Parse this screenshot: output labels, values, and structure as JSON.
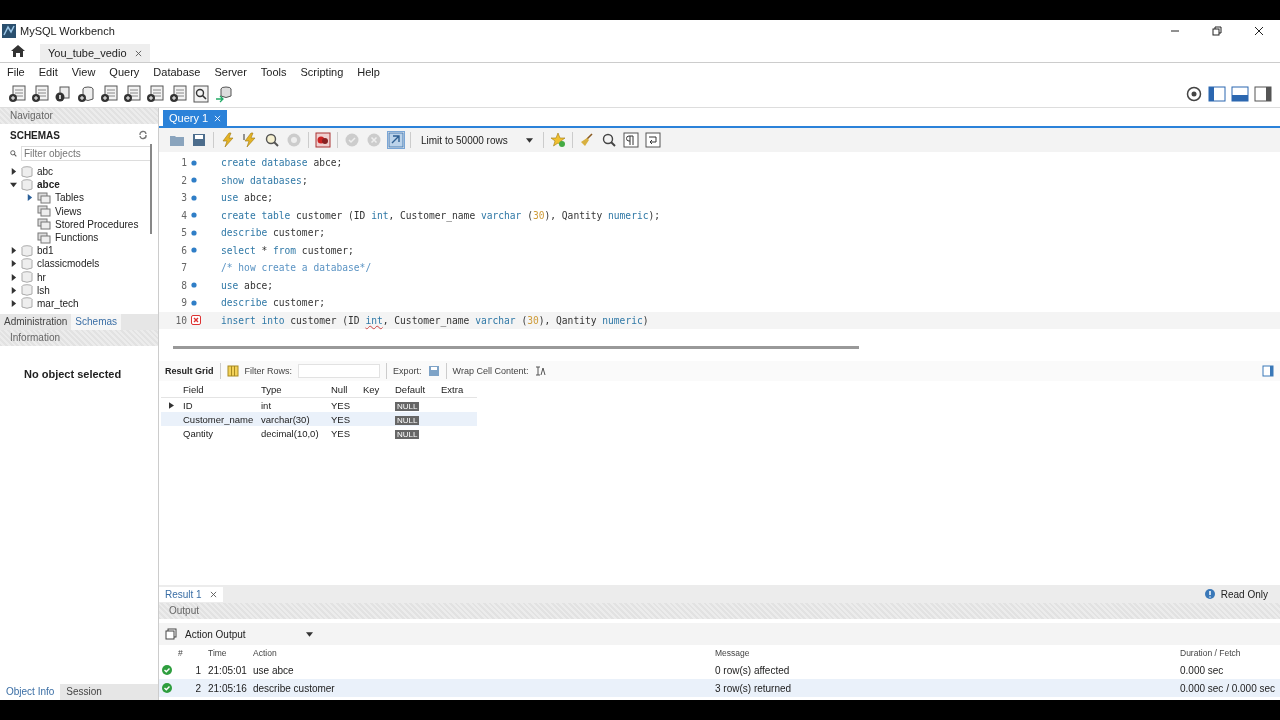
{
  "window": {
    "title": "MySQL Workbench"
  },
  "connection_tabs": [
    {
      "label": "You_tube_vedio",
      "selected": true
    }
  ],
  "menu": [
    "File",
    "Edit",
    "View",
    "Query",
    "Database",
    "Server",
    "Tools",
    "Scripting",
    "Help"
  ],
  "navigator": {
    "title": "Navigator",
    "heading": "SCHEMAS",
    "filter_placeholder": "Filter objects",
    "tree": [
      {
        "label": "abc",
        "kind": "schema",
        "expanded": false,
        "default": false
      },
      {
        "label": "abce",
        "kind": "schema",
        "expanded": true,
        "default": true,
        "children": [
          {
            "label": "Tables",
            "kind": "folder",
            "expanded": false
          },
          {
            "label": "Views",
            "kind": "group"
          },
          {
            "label": "Stored Procedures",
            "kind": "group"
          },
          {
            "label": "Functions",
            "kind": "group"
          }
        ]
      },
      {
        "label": "bd1",
        "kind": "schema",
        "expanded": false,
        "default": false
      },
      {
        "label": "classicmodels",
        "kind": "schema",
        "expanded": false,
        "default": false
      },
      {
        "label": "hr",
        "kind": "schema",
        "expanded": false,
        "default": false
      },
      {
        "label": "lsh",
        "kind": "schema",
        "expanded": false,
        "default": false
      },
      {
        "label": "mar_tech",
        "kind": "schema",
        "expanded": false,
        "default": false
      }
    ],
    "tabs": [
      {
        "label": "Administration",
        "selected": false
      },
      {
        "label": "Schemas",
        "selected": true
      }
    ]
  },
  "information": {
    "title": "Information",
    "text": "No object selected"
  },
  "bottom_tabs": [
    {
      "label": "Object Info",
      "selected": true
    },
    {
      "label": "Session",
      "selected": false
    }
  ],
  "editor": {
    "tab": "Query 1",
    "limit": "Limit to 50000 rows",
    "lines": [
      {
        "number": "1",
        "kind": "statement",
        "tokens": [
          {
            "kind": "kw",
            "text": "create database"
          },
          {
            "kind": "id",
            "text": " abce;"
          }
        ]
      },
      {
        "number": "2",
        "kind": "statement",
        "tokens": [
          {
            "kind": "kw",
            "text": "show databases"
          },
          {
            "kind": "id",
            "text": ";"
          }
        ]
      },
      {
        "number": "3",
        "kind": "statement",
        "tokens": [
          {
            "kind": "kw",
            "text": "use"
          },
          {
            "kind": "id",
            "text": " abce;"
          }
        ]
      },
      {
        "number": "4",
        "kind": "statement",
        "tokens": [
          {
            "kind": "kw",
            "text": "create table"
          },
          {
            "kind": "id",
            "text": " customer (ID "
          },
          {
            "kind": "kw",
            "text": "int"
          },
          {
            "kind": "id",
            "text": ", Customer_name "
          },
          {
            "kind": "kw",
            "text": "varchar"
          },
          {
            "kind": "id",
            "text": " ("
          },
          {
            "kind": "num",
            "text": "30"
          },
          {
            "kind": "id",
            "text": "), Qantity "
          },
          {
            "kind": "kw",
            "text": "numeric"
          },
          {
            "kind": "id",
            "text": ");"
          }
        ]
      },
      {
        "number": "5",
        "kind": "statement",
        "tokens": [
          {
            "kind": "kw",
            "text": "describe"
          },
          {
            "kind": "id",
            "text": " customer;"
          }
        ]
      },
      {
        "number": "6",
        "kind": "statement",
        "tokens": [
          {
            "kind": "kw",
            "text": "select"
          },
          {
            "kind": "id",
            "text": " * "
          },
          {
            "kind": "kw",
            "text": "from"
          },
          {
            "kind": "id",
            "text": " customer;"
          }
        ]
      },
      {
        "number": "7",
        "kind": "comment",
        "tokens": [
          {
            "kind": "comment",
            "text": "/* how create a database*/"
          }
        ]
      },
      {
        "number": "8",
        "kind": "statement",
        "tokens": [
          {
            "kind": "kw",
            "text": "use"
          },
          {
            "kind": "id",
            "text": " abce;"
          }
        ]
      },
      {
        "number": "9",
        "kind": "statement",
        "tokens": [
          {
            "kind": "kw",
            "text": "describe"
          },
          {
            "kind": "id",
            "text": " customer;"
          }
        ]
      },
      {
        "number": "10",
        "kind": "error",
        "tokens": [
          {
            "kind": "kw",
            "text": "insert into"
          },
          {
            "kind": "id",
            "text": " customer (ID "
          },
          {
            "kind": "error",
            "text": "int"
          },
          {
            "kind": "id",
            "text": ", Customer_name "
          },
          {
            "kind": "kw",
            "text": "varchar"
          },
          {
            "kind": "id",
            "text": " ("
          },
          {
            "kind": "num",
            "text": "30"
          },
          {
            "kind": "id",
            "text": "), Qantity "
          },
          {
            "kind": "kw",
            "text": "numeric"
          },
          {
            "kind": "id",
            "text": ")"
          }
        ]
      }
    ]
  },
  "result": {
    "toolbar": {
      "grid": "Result Grid",
      "filter": "Filter Rows:",
      "export": "Export:",
      "wrap": "Wrap Cell Content:"
    },
    "columns": [
      "Field",
      "Type",
      "Null",
      "Key",
      "Default",
      "Extra"
    ],
    "rows": [
      {
        "current": true,
        "selected": false,
        "cells": [
          "ID",
          "int",
          "YES",
          "",
          "NULL",
          ""
        ]
      },
      {
        "current": false,
        "selected": true,
        "cells": [
          "Customer_name",
          "varchar(30)",
          "YES",
          "",
          "NULL",
          ""
        ]
      },
      {
        "current": false,
        "selected": false,
        "cells": [
          "Qantity",
          "decimal(10,0)",
          "YES",
          "",
          "NULL",
          ""
        ]
      }
    ],
    "tab": "Result 1",
    "status": "Read Only"
  },
  "output": {
    "title": "Output",
    "selector": "Action Output",
    "columns": [
      "#",
      "Time",
      "Action",
      "Message",
      "Duration / Fetch"
    ],
    "rows": [
      {
        "kind": "success",
        "selected": false,
        "cells": [
          "1",
          "21:05:01",
          "use abce",
          "0 row(s) affected",
          "0.000 sec"
        ]
      },
      {
        "kind": "success",
        "selected": true,
        "cells": [
          "2",
          "21:05:16",
          "describe customer",
          "3 row(s) returned",
          "0.000 sec / 0.000 sec"
        ]
      }
    ]
  }
}
